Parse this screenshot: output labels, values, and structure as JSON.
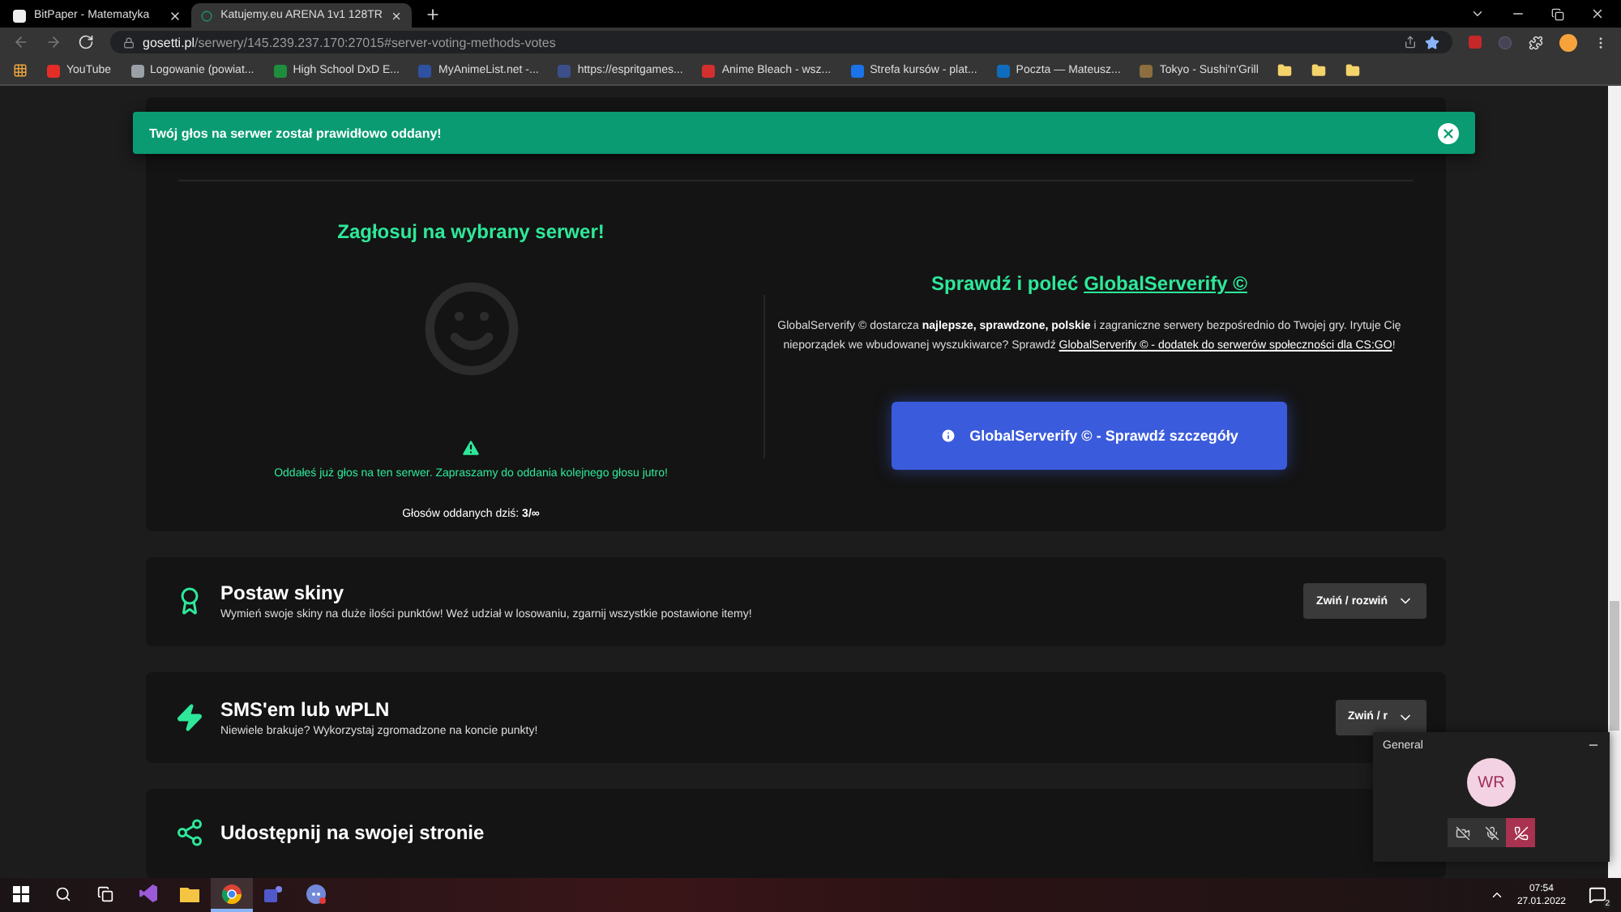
{
  "browser": {
    "tabs": [
      {
        "title": "BitPaper - Matematyka",
        "selected": false
      },
      {
        "title": "Katujemy.eu ARENA 1v1 128TR",
        "selected": true
      }
    ],
    "url_host": "gosetti.pl",
    "url_path": "/serwery/145.239.237.170:27015#server-voting-methods-votes",
    "bookmarks": [
      {
        "kind": "apps"
      },
      {
        "kind": "link",
        "label": "YouTube",
        "color": "#e52d27"
      },
      {
        "kind": "link",
        "label": "Logowanie (powiat...",
        "color": "#9aa0a6"
      },
      {
        "kind": "link",
        "label": "High School DxD E...",
        "color": "#1e8e3e"
      },
      {
        "kind": "link",
        "label": "MyAnimeList.net -...",
        "color": "#2e51a2"
      },
      {
        "kind": "link",
        "label": "https://espritgames...",
        "color": "#3c4f8a"
      },
      {
        "kind": "link",
        "label": "Anime Bleach - wsz...",
        "color": "#d32f2f"
      },
      {
        "kind": "link",
        "label": "Strefa kursów - plat...",
        "color": "#1a73e8"
      },
      {
        "kind": "link",
        "label": "Poczta — Mateusz...",
        "color": "#0f6cbd"
      },
      {
        "kind": "link",
        "label": "Tokyo - Sushi'n'Grill",
        "color": "#8d6e3f"
      },
      {
        "kind": "folder"
      },
      {
        "kind": "folder"
      },
      {
        "kind": "folder"
      }
    ]
  },
  "alert": {
    "message": "Twój głos na serwer został prawidłowo oddany!"
  },
  "vote": {
    "title": "Zagłosuj na wybrany serwer!",
    "warning": "Oddałeś już głos na ten serwer. Zapraszamy do oddania kolejnego głosu jutro!",
    "count": "Głosów oddanych dziś: **3/∞**"
  },
  "promo": {
    "heading": "Sprawdź i poleć",
    "heading_link": "GlobalServerify ©",
    "text": "GlobalServerify © dostarcza **najlepsze, sprawdzone, polskie** i zagraniczne serwery bezpośrednio do Twojej gry. Irytuje Cię nieporządek we wbudowanej wyszukiwarce? Sprawdź",
    "text_link": "GlobalServerify © - dodatek do serwerów społeczności dla CS:GO",
    "text_end": "!",
    "button": "GlobalServerify © - Sprawdź szczegóły"
  },
  "sections": [
    {
      "kind": "award",
      "title": "Postaw skiny",
      "description": "Wymień swoje skiny na duże ilości punktów! Weź udział w losowaniu, zgarnij wszystkie postawione itemy!",
      "button": "Zwiń / rozwiń"
    },
    {
      "kind": "bolt",
      "title": "SMS'em lub wPLN",
      "description": "Niewiele brakuje? Wykorzystaj zgromadzone na koncie punkty!",
      "button": "Zwiń / r"
    },
    {
      "kind": "share",
      "title": "Udostępnij na swojej stronie"
    }
  ],
  "call": {
    "title": "General",
    "initials": "WR"
  },
  "taskbar": {
    "apps": [
      {
        "kind": "visual-studio",
        "selected": false
      },
      {
        "kind": "explorer",
        "selected": false
      },
      {
        "kind": "chrome",
        "selected": true
      },
      {
        "kind": "teams",
        "selected": false
      },
      {
        "kind": "discord",
        "selected": false
      }
    ],
    "time": "07:54",
    "date": "27.01.2022",
    "notifications": "2"
  }
}
